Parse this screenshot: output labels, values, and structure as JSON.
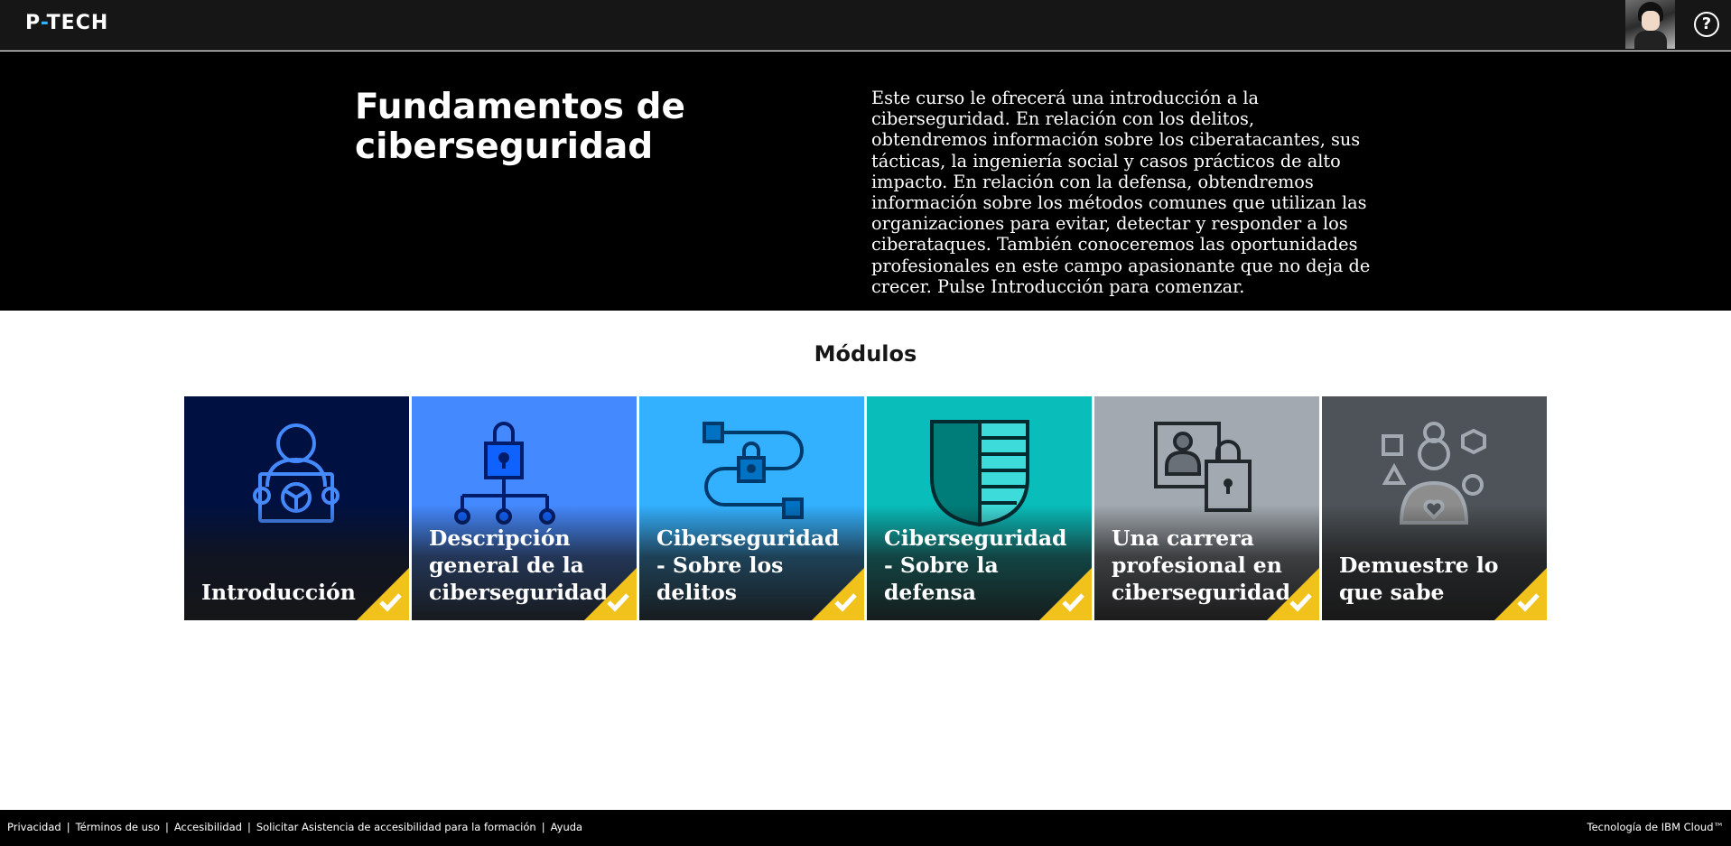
{
  "header": {
    "logo_prefix": "P",
    "logo_dash": "-",
    "logo_suffix": "TECH",
    "help_icon": "help-icon",
    "help_glyph": "?"
  },
  "hero": {
    "title": "Fundamentos de ciberseguridad",
    "description": "Este curso le ofrecerá una introducción a la ciberseguridad. En relación con los delitos, obtendremos información sobre los ciberatacantes, sus tácticas, la ingeniería social y casos prácticos de alto impacto. En relación con la defensa, obtendremos información sobre los métodos comunes que utilizan las organizaciones para evitar, detectar y responder a los ciberataques. También conoceremos las oportunidades profesionales en este campo apasionante que no deja de crecer. Pulse Introducción para comenzar."
  },
  "modules": {
    "title": "Módulos",
    "items": [
      {
        "label": "Introducción",
        "icon": "person-presenting-icon",
        "bg": "#001141",
        "status": "completed"
      },
      {
        "label": "Descripción general de la ciberseguridad",
        "icon": "lock-network-icon",
        "bg": "#4589ff",
        "status": "completed"
      },
      {
        "label": "Ciberseguridad - Sobre los delitos",
        "icon": "lock-path-icon",
        "bg": "#33b1ff",
        "status": "completed"
      },
      {
        "label": "Ciberseguridad - Sobre la defensa",
        "icon": "shield-icon",
        "bg": "#08bdba",
        "status": "completed"
      },
      {
        "label": "Una carrera profesional en ciberseguridad",
        "icon": "id-badge-lock-icon",
        "bg": "#a2a9b0",
        "status": "completed"
      },
      {
        "label": "Demuestre lo que sabe",
        "icon": "person-shapes-icon",
        "bg": "#4d5358",
        "status": "completed"
      }
    ]
  },
  "colors": {
    "badge": "#f1c21b",
    "topbar": "#161616",
    "accent": "#33b1ff"
  },
  "footer": {
    "links": [
      "Privacidad",
      "Términos de uso",
      "Accesibilidad",
      "Solicitar Asistencia de accesibilidad para la formación",
      "Ayuda"
    ],
    "separator": "|",
    "right_text": "Tecnología de IBM Cloud™"
  }
}
